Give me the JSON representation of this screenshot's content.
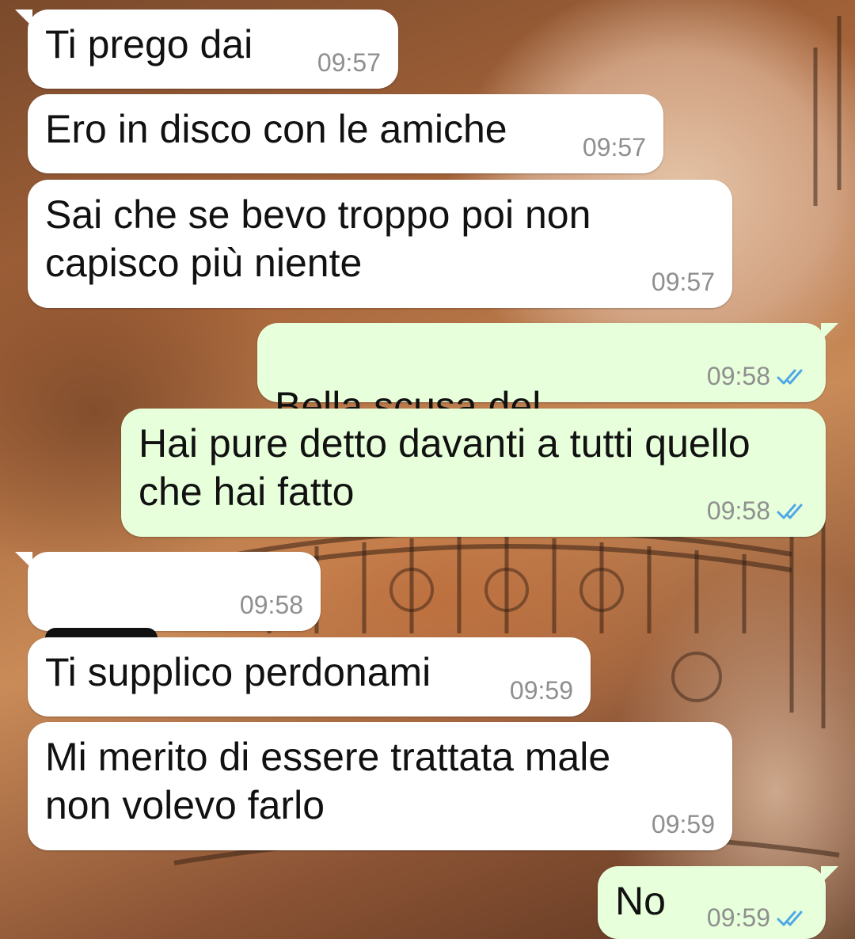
{
  "chat": {
    "messages": [
      {
        "direction": "incoming",
        "text": "Ti prego dai",
        "time": "09:57"
      },
      {
        "direction": "incoming",
        "text": "Ero in disco con le amiche",
        "time": "09:57"
      },
      {
        "direction": "incoming",
        "text": "Sai che se bevo troppo poi non\ncapisco più niente",
        "time": "09:57"
      },
      {
        "direction": "outgoing",
        "text": "Bella scusa del",
        "time": "09:58",
        "status": "read"
      },
      {
        "direction": "outgoing",
        "text": "Hai pure detto davanti a tutti quello\nche hai fatto",
        "time": "09:58",
        "status": "read"
      },
      {
        "direction": "incoming",
        "text": "..",
        "time": "09:58"
      },
      {
        "direction": "incoming",
        "text": "Ti supplico perdonami",
        "time": "09:59"
      },
      {
        "direction": "incoming",
        "text": "Mi merito di essere trattata male\nnon volevo farlo",
        "time": "09:59"
      },
      {
        "direction": "outgoing",
        "text": "No",
        "time": "09:59",
        "status": "read"
      }
    ]
  },
  "colors": {
    "incoming_bubble": "#ffffff",
    "outgoing_bubble": "#e7ffdb",
    "read_ticks": "#4fa8e6",
    "timestamp": "#8f8f8f"
  },
  "icons": {
    "read_receipt": "double-check-icon",
    "redaction": "redaction-scribble"
  }
}
